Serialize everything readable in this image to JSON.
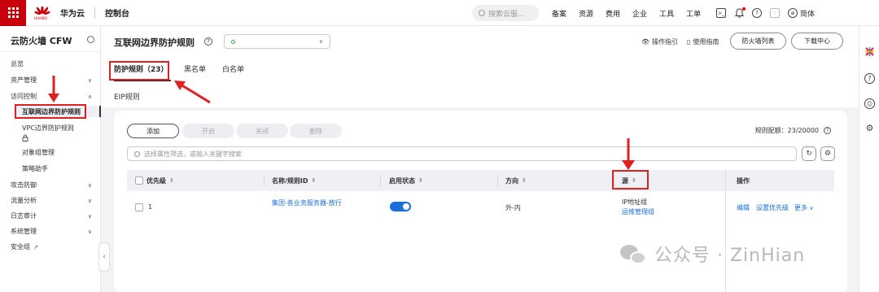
{
  "topbar": {
    "brand_mark": "HUAWEI",
    "brand_name": "华为云",
    "console": "控制台",
    "search_placeholder": "搜索云服...",
    "nav": [
      "备案",
      "资源",
      "费用",
      "企业",
      "工具",
      "工单"
    ],
    "language": "简体"
  },
  "sidebar": {
    "title": "云防火墙 CFW",
    "items": [
      {
        "label": "总览",
        "chevron": ""
      },
      {
        "label": "资产管理",
        "chevron": "∨"
      },
      {
        "label": "访问控制",
        "chevron": "∧"
      }
    ],
    "access_children": [
      "互联网边界防护规则",
      "VPC边界防护规则",
      "对象组管理",
      "策略助手"
    ],
    "items_after": [
      {
        "label": "攻击防御",
        "chevron": "∨"
      },
      {
        "label": "流量分析",
        "chevron": "∨"
      },
      {
        "label": "日志审计",
        "chevron": "∨"
      },
      {
        "label": "系统管理",
        "chevron": "∨"
      },
      {
        "label": "安全组",
        "chevron": ""
      }
    ]
  },
  "header": {
    "title": "互联网边界防护规则",
    "help": "?",
    "links": [
      "操作指引",
      "使用指南"
    ],
    "buttons": [
      "防火墙列表",
      "下载中心"
    ]
  },
  "tabs": [
    "防护规则（23）",
    "黑名单",
    "白名单"
  ],
  "section_label": "EIP规则",
  "toolbar": {
    "add": "添加",
    "disabled": [
      "开启",
      "关闭",
      "删除"
    ],
    "quota": "规则配额：23/20000",
    "filter_placeholder": "选择属性筛选，或输入关键字搜索"
  },
  "table": {
    "columns": [
      "优先级",
      "名称/规则ID",
      "启用状态",
      "方向",
      "源",
      "操作"
    ],
    "rows": [
      {
        "priority": "1",
        "name": "集团-各业务服务器-放行",
        "enabled": true,
        "direction": "外-内",
        "source_type": "IP地址组",
        "source_value": "运维管理组",
        "actions": [
          "编辑",
          "设置优先级",
          "更多"
        ]
      }
    ]
  },
  "watermark": "公众号 · ZinHian",
  "colors": {
    "brand": "#c7000b",
    "link": "#1a6fd8",
    "annotation": "#e02020",
    "toggle_on": "#1a6fd8"
  }
}
